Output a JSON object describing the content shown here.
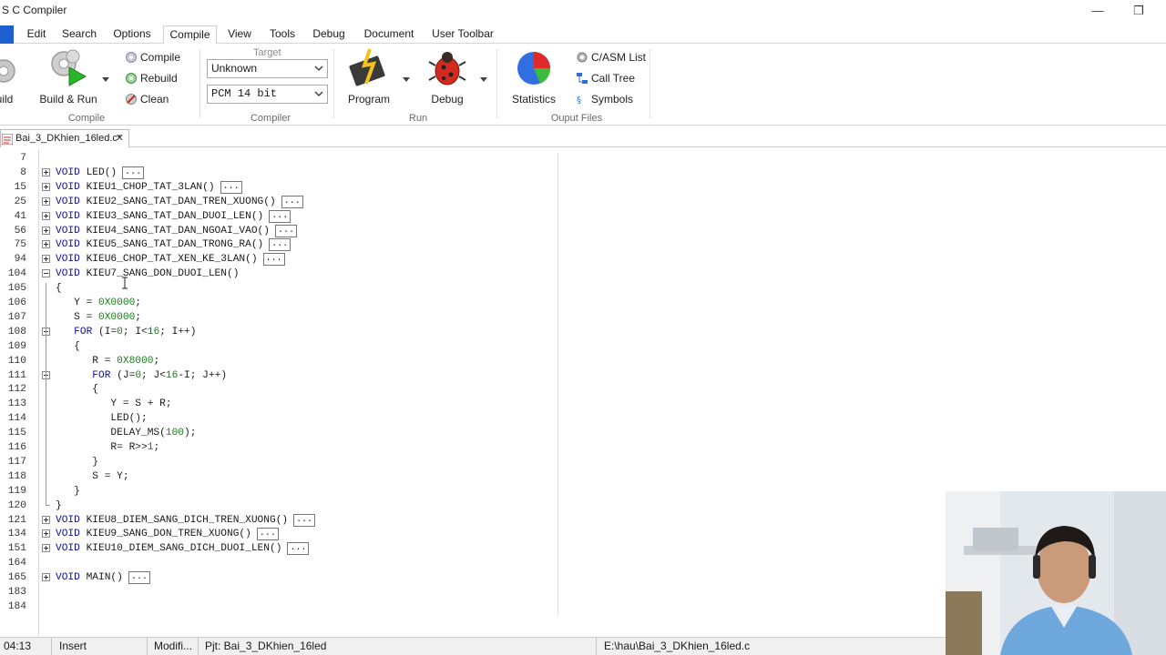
{
  "window": {
    "title": "S C Compiler",
    "minimize_glyph": "—",
    "restore_glyph": "❐"
  },
  "menu": {
    "tabs": [
      "Edit",
      "Search",
      "Options",
      "Compile",
      "View",
      "Tools",
      "Debug",
      "Document",
      "User Toolbar"
    ],
    "active_tab": "Compile"
  },
  "ribbon": {
    "build_partial_label": "uild",
    "build_run_label": "Build & Run",
    "compile_label": "Compile",
    "rebuild_label": "Rebuild",
    "clean_label": "Clean",
    "group_compile": "Compile",
    "target_label": "Target",
    "target_value": "Unknown",
    "mode_value": "PCM 14 bit",
    "group_compiler": "Compiler",
    "program_label": "Program",
    "debug_label": "Debug",
    "group_run": "Run",
    "statistics_label": "Statistics",
    "casm_label": "C/ASM List",
    "calltree_label": "Call Tree",
    "symbols_label": "Symbols",
    "group_output": "Ouput Files"
  },
  "document": {
    "tab_label": "Bai_3_DKhien_16led.c*",
    "close_glyph": "✕"
  },
  "code_lines": [
    {
      "ln": "7",
      "fold": "",
      "code": ""
    },
    {
      "ln": "8",
      "fold": "plus",
      "code": "VOID LED()",
      "collapsed": true
    },
    {
      "ln": "15",
      "fold": "plus",
      "code": "VOID KIEU1_CHOP_TAT_3LAN()",
      "collapsed": true
    },
    {
      "ln": "25",
      "fold": "plus",
      "code": "VOID KIEU2_SANG_TAT_DAN_TREN_XUONG()",
      "collapsed": true
    },
    {
      "ln": "41",
      "fold": "plus",
      "code": "VOID KIEU3_SANG_TAT_DAN_DUOI_LEN()",
      "collapsed": true
    },
    {
      "ln": "56",
      "fold": "plus",
      "code": "VOID KIEU4_SANG_TAT_DAN_NGOAI_VAO()",
      "collapsed": true
    },
    {
      "ln": "75",
      "fold": "plus",
      "code": "VOID KIEU5_SANG_TAT_DAN_TRONG_RA()",
      "collapsed": true
    },
    {
      "ln": "94",
      "fold": "plus",
      "code": "VOID KIEU6_CHOP_TAT_XEN_KE_3LAN()",
      "collapsed": true
    },
    {
      "ln": "104",
      "fold": "minus",
      "code": "VOID KIEU7_SANG_DON_DUOI_LEN()"
    },
    {
      "ln": "105",
      "fold": "",
      "code": "{"
    },
    {
      "ln": "106",
      "fold": "",
      "code": "   Y = 0X0000;"
    },
    {
      "ln": "107",
      "fold": "",
      "code": "   S = 0X0000;"
    },
    {
      "ln": "108",
      "fold": "minus",
      "code": "   FOR (I=0; I<16; I++)"
    },
    {
      "ln": "109",
      "fold": "",
      "code": "   {"
    },
    {
      "ln": "110",
      "fold": "",
      "code": "      R = 0X8000;"
    },
    {
      "ln": "111",
      "fold": "minus",
      "code": "      FOR (J=0; J<16-I; J++)"
    },
    {
      "ln": "112",
      "fold": "",
      "code": "      {"
    },
    {
      "ln": "113",
      "fold": "",
      "code": "         Y = S + R;"
    },
    {
      "ln": "114",
      "fold": "",
      "code": "         LED();"
    },
    {
      "ln": "115",
      "fold": "",
      "code": "         DELAY_MS(100);"
    },
    {
      "ln": "116",
      "fold": "",
      "code": "         R= R>>1;"
    },
    {
      "ln": "117",
      "fold": "",
      "code": "      }"
    },
    {
      "ln": "118",
      "fold": "",
      "code": "      S = Y;"
    },
    {
      "ln": "119",
      "fold": "",
      "code": "   }"
    },
    {
      "ln": "120",
      "fold": "",
      "code": "}"
    },
    {
      "ln": "121",
      "fold": "plus",
      "code": "VOID KIEU8_DIEM_SANG_DICH_TREN_XUONG()",
      "collapsed": true
    },
    {
      "ln": "134",
      "fold": "plus",
      "code": "VOID KIEU9_SANG_DON_TREN_XUONG()",
      "collapsed": true
    },
    {
      "ln": "151",
      "fold": "plus",
      "code": "VOID KIEU10_DIEM_SANG_DICH_DUOI_LEN()",
      "collapsed": true
    },
    {
      "ln": "164",
      "fold": "",
      "code": ""
    },
    {
      "ln": "165",
      "fold": "plus",
      "code": "VOID MAIN()",
      "collapsed": true
    },
    {
      "ln": "183",
      "fold": "",
      "code": ""
    },
    {
      "ln": "184",
      "fold": "",
      "code": ""
    }
  ],
  "collapsed_marker": "...",
  "statusbar": {
    "position": "04:13",
    "mode": "Insert",
    "modified": "Modifi...",
    "project": "Pjt: Bai_3_DKhien_16led",
    "path": "E:\\hau\\Bai_3_DKhien_16led.c"
  },
  "colors": {
    "keyword": "#1010a0",
    "number": "#1b7f1b",
    "accent": "#1e5fd1"
  }
}
